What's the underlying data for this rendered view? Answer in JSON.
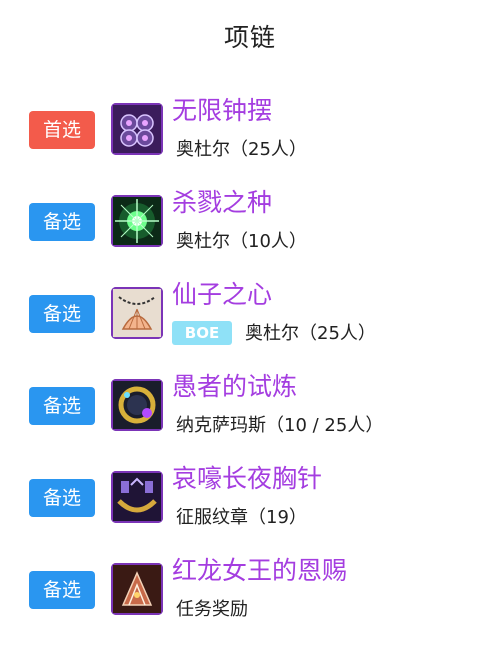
{
  "page": {
    "title": "项链"
  },
  "items": [
    {
      "tag": "首选",
      "name": "无限钟摆",
      "source": "奥杜尔（25人）",
      "boe": "",
      "icon": "pendulum-icon"
    },
    {
      "tag": "备选",
      "name": "杀戮之种",
      "source": "奥杜尔（10人）",
      "boe": "",
      "icon": "seed-of-slaughter-icon"
    },
    {
      "tag": "备选",
      "name": "仙子之心",
      "source": "奥杜尔（25人）",
      "boe": "BOE",
      "icon": "shell-necklace-icon"
    },
    {
      "tag": "备选",
      "name": "愚者的试炼",
      "source": "纳克萨玛斯（10 / 25人）",
      "boe": "",
      "icon": "fools-trial-icon"
    },
    {
      "tag": "备选",
      "name": "哀嚎长夜胸针",
      "source": "征服纹章（19）",
      "boe": "",
      "icon": "brooch-icon"
    },
    {
      "tag": "备选",
      "name": "红龙女王的恩赐",
      "source": "任务奖励",
      "boe": "",
      "icon": "dragon-queen-icon"
    }
  ],
  "colors": {
    "primary_tag": "#f35b4b",
    "backup_tag": "#2a96f0",
    "item_name": "#a43de0",
    "boe_badge": "#8fe1f7"
  }
}
